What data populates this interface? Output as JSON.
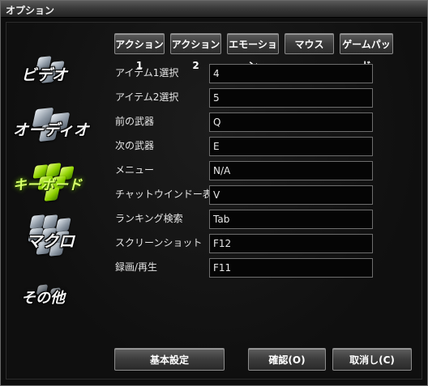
{
  "window": {
    "title": "オプション"
  },
  "tabs": [
    {
      "label": "アクション1"
    },
    {
      "label": "アクション2"
    },
    {
      "label": "エモーション"
    },
    {
      "label": "マウス"
    },
    {
      "label": "ゲームパッド"
    }
  ],
  "sidebar": {
    "items": [
      {
        "label": "ビデオ",
        "icon": "video-icon"
      },
      {
        "label": "オーディオ",
        "icon": "audio-icon"
      },
      {
        "label": "キーボード",
        "icon": "keyboard-icon",
        "active": true
      },
      {
        "label": "マクロ",
        "icon": "macro-icon"
      },
      {
        "label": "その他",
        "icon": "other-icon"
      }
    ]
  },
  "settings": [
    {
      "label": "アイテム1選択",
      "value": "4"
    },
    {
      "label": "アイテム2選択",
      "value": "5"
    },
    {
      "label": "前の武器",
      "value": "Q"
    },
    {
      "label": "次の武器",
      "value": "E"
    },
    {
      "label": "メニュー",
      "value": "N/A"
    },
    {
      "label": "チャットウインドー表示",
      "value": "V"
    },
    {
      "label": "ランキング検索",
      "value": "Tab"
    },
    {
      "label": "スクリーンショット",
      "value": "F12"
    },
    {
      "label": "録画/再生",
      "value": "F11"
    }
  ],
  "buttons": {
    "defaults": "基本設定",
    "confirm": "確認(O)",
    "cancel": "取消し(C)"
  },
  "colors": {
    "accent_active": "#8ed000",
    "background": "#0e0e0e"
  }
}
